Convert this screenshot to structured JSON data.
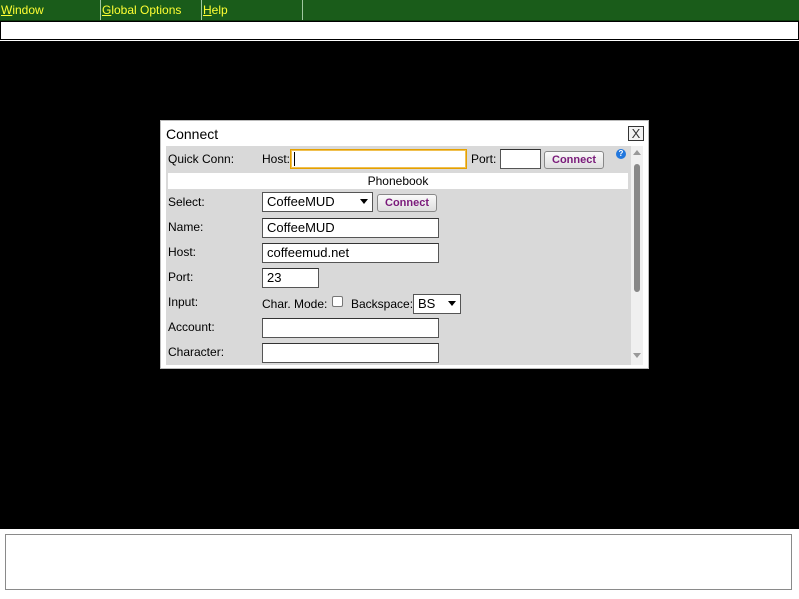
{
  "menubar": {
    "items": [
      {
        "accel": "W",
        "rest": "indow"
      },
      {
        "accel": "G",
        "rest": "lobal Options"
      },
      {
        "accel": "H",
        "rest": "elp"
      }
    ]
  },
  "dialog": {
    "title": "Connect",
    "close": "X",
    "quick_conn": {
      "label": "Quick Conn:",
      "host_label": "Host:",
      "host_value": "",
      "port_label": "Port:",
      "port_value": "",
      "connect_label": "Connect",
      "help": "?"
    },
    "phonebook": {
      "header": "Phonebook",
      "select_label": "Select:",
      "select_value": "CoffeeMUD",
      "connect_label": "Connect",
      "name_label": "Name:",
      "name_value": "CoffeeMUD",
      "host_label": "Host:",
      "host_value": "coffeemud.net",
      "port_label": "Port:",
      "port_value": "23",
      "input_label": "Input:",
      "char_mode_label": "Char. Mode:",
      "backspace_label": "Backspace:",
      "backspace_value": "BS",
      "account_label": "Account:",
      "account_value": "",
      "character_label": "Character:",
      "character_value": ""
    }
  },
  "colors": {
    "menubar_bg": "#1a5c1a",
    "menu_text": "#ffff33",
    "terminal_bg": "#000000",
    "dialog_body": "#d9d9d9",
    "button_text": "#7a1a7a"
  }
}
